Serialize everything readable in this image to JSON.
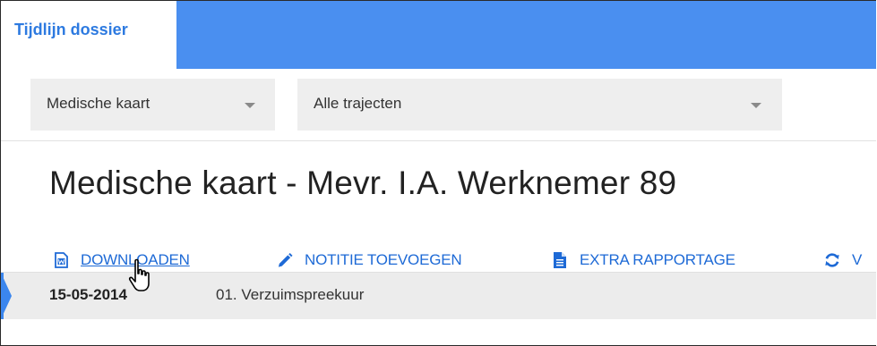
{
  "tab": {
    "label": "Tijdlijn dossier"
  },
  "filters": {
    "card_select": {
      "value": "Medische kaart"
    },
    "trajectory_select": {
      "value": "Alle trajecten"
    }
  },
  "page": {
    "title": "Medische kaart - Mevr. I.A. Werknemer 89"
  },
  "actions": {
    "download": {
      "label": "DOWNLOADEN",
      "icon": "word-document-icon"
    },
    "add_note": {
      "label": "NOTITIE TOEVOEGEN",
      "icon": "pencil-icon"
    },
    "extra_report": {
      "label": "EXTRA RAPPORTAGE",
      "icon": "document-icon"
    },
    "refresh": {
      "label": "V",
      "icon": "refresh-icon"
    }
  },
  "timeline": {
    "items": [
      {
        "date": "15-05-2014",
        "description": "01. Verzuimspreekuur"
      }
    ]
  },
  "colors": {
    "accent": "#4a8ff0",
    "link": "#1e6ad6",
    "tab_text": "#2d7ae0",
    "select_bg": "#eeeeee",
    "timeline_bg": "#ececec"
  }
}
